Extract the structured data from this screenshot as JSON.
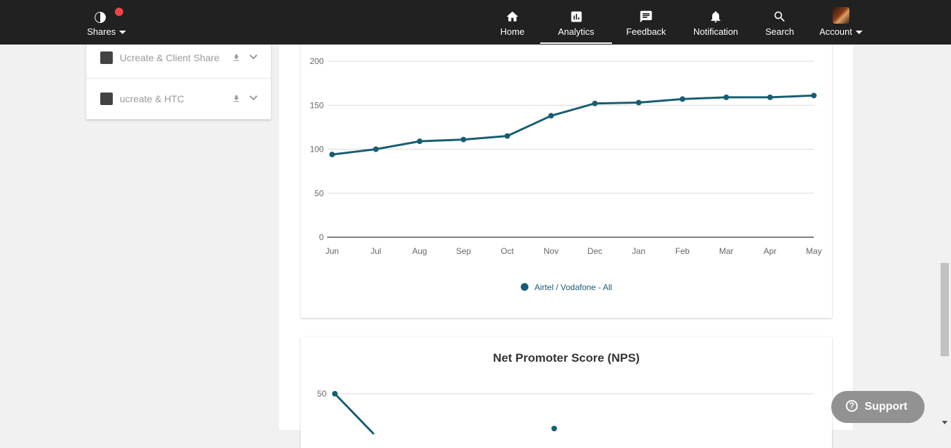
{
  "topbar": {
    "brand_label": "Shares",
    "nav": [
      {
        "label": "Home",
        "icon": "home-icon"
      },
      {
        "label": "Analytics",
        "icon": "bar-chart-icon",
        "active": true
      },
      {
        "label": "Feedback",
        "icon": "chat-bubble-icon"
      },
      {
        "label": "Notification",
        "icon": "bell-icon"
      },
      {
        "label": "Search",
        "icon": "search-icon"
      },
      {
        "label": "Account",
        "icon": "avatar"
      }
    ]
  },
  "shares": [
    {
      "name": "Ucreate & Client Share"
    },
    {
      "name": "ucreate & HTC"
    }
  ],
  "chart1": {
    "legend": "Airtel / Vodafone - All"
  },
  "chart2": {
    "title": "Net Promoter Score (NPS)"
  },
  "support": {
    "label": "Support",
    "icon_glyph": "?"
  },
  "colors": {
    "topbar": "#212121",
    "series": "#175d72",
    "notification_dot": "#ef4444",
    "support_button": "#929292"
  },
  "chart_data": [
    {
      "type": "line",
      "categories": [
        "Jun",
        "Jul",
        "Aug",
        "Sep",
        "Oct",
        "Nov",
        "Dec",
        "Jan",
        "Feb",
        "Mar",
        "Apr",
        "May"
      ],
      "series": [
        {
          "name": "Airtel / Vodafone - All",
          "values": [
            94,
            100,
            109,
            111,
            115,
            138,
            152,
            153,
            157,
            159,
            159,
            161
          ]
        }
      ],
      "yticks": [
        0,
        50,
        100,
        150,
        200
      ],
      "ylim": [
        0,
        200
      ],
      "grid": true,
      "legend_position": "bottom"
    },
    {
      "type": "line",
      "title": "Net Promoter Score (NPS)",
      "yticks": [
        50
      ]
    }
  ]
}
